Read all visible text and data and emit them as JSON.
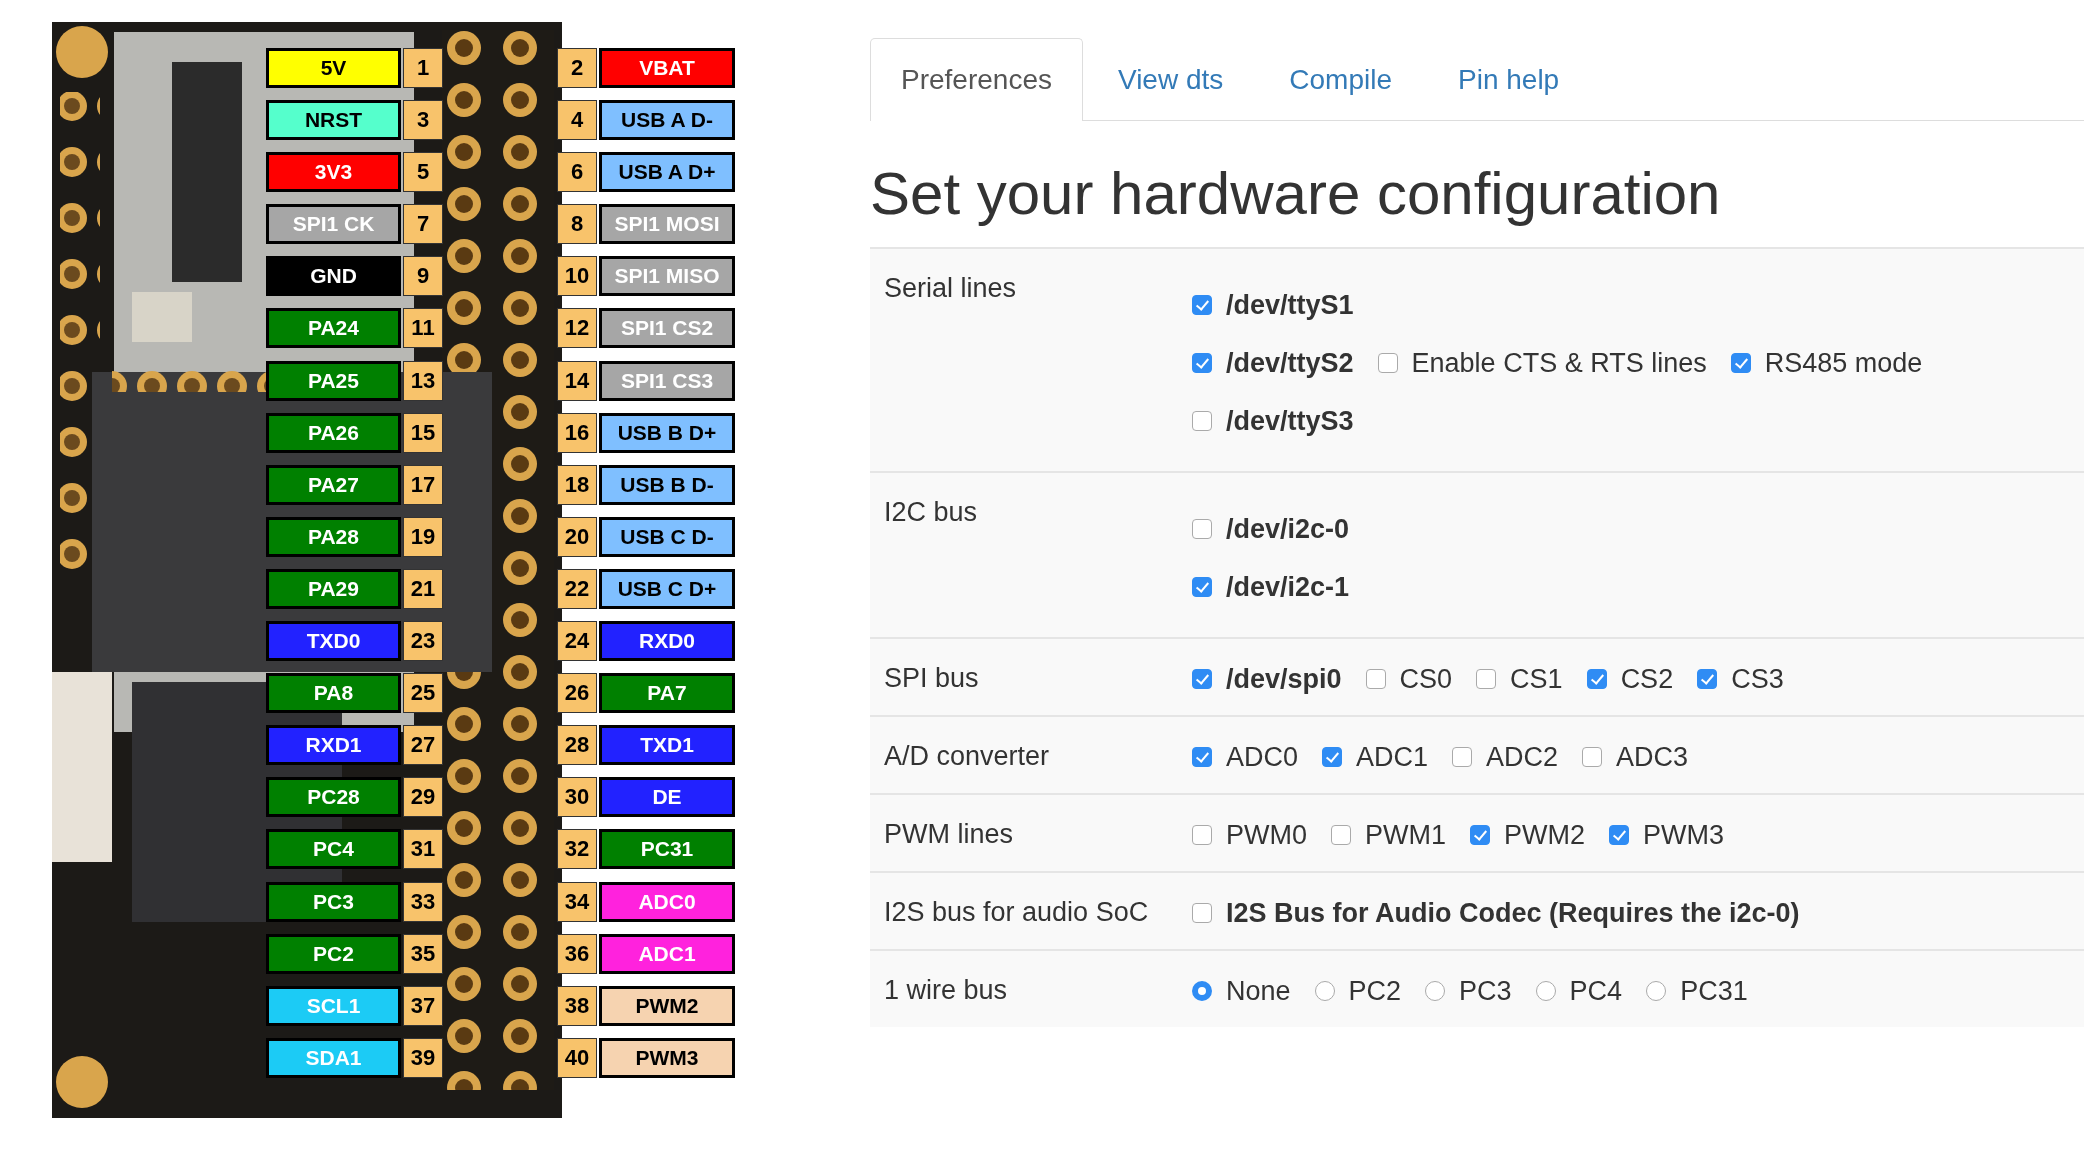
{
  "board": {
    "kind": "picture",
    "pin_rows": [
      {
        "left": {
          "name": "5V",
          "number": "1",
          "color": "#ffff00",
          "kind": "dark-text"
        },
        "right": {
          "number": "2",
          "name": "VBAT",
          "color": "#ff0000",
          "kind": "light-text"
        }
      },
      {
        "left": {
          "name": "NRST",
          "number": "3",
          "color": "#55ffcc",
          "kind": "dark-text"
        },
        "right": {
          "number": "4",
          "name": "USB A D-",
          "color": "#7fbfff",
          "kind": "dark-text"
        }
      },
      {
        "left": {
          "name": "3V3",
          "number": "5",
          "color": "#ff0000",
          "kind": "light-text"
        },
        "right": {
          "number": "6",
          "name": "USB A D+",
          "color": "#7fbfff",
          "kind": "dark-text"
        }
      },
      {
        "left": {
          "name": "SPI1 CK",
          "number": "7",
          "color": "#a6a6a6",
          "kind": "light-text"
        },
        "right": {
          "number": "8",
          "name": "SPI1 MOSI",
          "color": "#a6a6a6",
          "kind": "light-text"
        }
      },
      {
        "left": {
          "name": "GND",
          "number": "9",
          "color": "#000000",
          "kind": "light-text"
        },
        "right": {
          "number": "10",
          "name": "SPI1 MISO",
          "color": "#a6a6a6",
          "kind": "light-text"
        }
      },
      {
        "left": {
          "name": "PA24",
          "number": "11",
          "color": "#008000",
          "kind": "light-text"
        },
        "right": {
          "number": "12",
          "name": "SPI1 CS2",
          "color": "#a6a6a6",
          "kind": "light-text"
        }
      },
      {
        "left": {
          "name": "PA25",
          "number": "13",
          "color": "#008000",
          "kind": "light-text"
        },
        "right": {
          "number": "14",
          "name": "SPI1 CS3",
          "color": "#a6a6a6",
          "kind": "light-text"
        }
      },
      {
        "left": {
          "name": "PA26",
          "number": "15",
          "color": "#008000",
          "kind": "light-text"
        },
        "right": {
          "number": "16",
          "name": "USB B D+",
          "color": "#7fbfff",
          "kind": "dark-text"
        }
      },
      {
        "left": {
          "name": "PA27",
          "number": "17",
          "color": "#008000",
          "kind": "light-text"
        },
        "right": {
          "number": "18",
          "name": "USB B D-",
          "color": "#7fbfff",
          "kind": "dark-text"
        }
      },
      {
        "left": {
          "name": "PA28",
          "number": "19",
          "color": "#008000",
          "kind": "light-text"
        },
        "right": {
          "number": "20",
          "name": "USB C D-",
          "color": "#7fbfff",
          "kind": "dark-text"
        }
      },
      {
        "left": {
          "name": "PA29",
          "number": "21",
          "color": "#008000",
          "kind": "light-text"
        },
        "right": {
          "number": "22",
          "name": "USB C D+",
          "color": "#7fbfff",
          "kind": "dark-text"
        }
      },
      {
        "left": {
          "name": "TXD0",
          "number": "23",
          "color": "#2222ff",
          "kind": "light-text"
        },
        "right": {
          "number": "24",
          "name": "RXD0",
          "color": "#2222ff",
          "kind": "light-text"
        }
      },
      {
        "left": {
          "name": "PA8",
          "number": "25",
          "color": "#008000",
          "kind": "light-text"
        },
        "right": {
          "number": "26",
          "name": "PA7",
          "color": "#008000",
          "kind": "light-text"
        }
      },
      {
        "left": {
          "name": "RXD1",
          "number": "27",
          "color": "#2222ff",
          "kind": "light-text"
        },
        "right": {
          "number": "28",
          "name": "TXD1",
          "color": "#2222ff",
          "kind": "light-text"
        }
      },
      {
        "left": {
          "name": "PC28",
          "number": "29",
          "color": "#008000",
          "kind": "light-text"
        },
        "right": {
          "number": "30",
          "name": "DE",
          "color": "#2222ff",
          "kind": "light-text"
        }
      },
      {
        "left": {
          "name": "PC4",
          "number": "31",
          "color": "#008000",
          "kind": "light-text"
        },
        "right": {
          "number": "32",
          "name": "PC31",
          "color": "#008000",
          "kind": "light-text"
        }
      },
      {
        "left": {
          "name": "PC3",
          "number": "33",
          "color": "#008000",
          "kind": "light-text"
        },
        "right": {
          "number": "34",
          "name": "ADC0",
          "color": "#ff22dd",
          "kind": "light-text"
        }
      },
      {
        "left": {
          "name": "PC2",
          "number": "35",
          "color": "#008000",
          "kind": "light-text"
        },
        "right": {
          "number": "36",
          "name": "ADC1",
          "color": "#ff22dd",
          "kind": "light-text"
        }
      },
      {
        "left": {
          "name": "SCL1",
          "number": "37",
          "color": "#1ccbf5",
          "kind": "light-text"
        },
        "right": {
          "number": "38",
          "name": "PWM2",
          "color": "#f6d3b0",
          "kind": "dark-text"
        }
      },
      {
        "left": {
          "name": "SDA1",
          "number": "39",
          "color": "#1ccbf5",
          "kind": "light-text"
        },
        "right": {
          "number": "40",
          "name": "PWM3",
          "color": "#f6d3b0",
          "kind": "dark-text"
        }
      }
    ]
  },
  "tabs": [
    {
      "label": "Preferences",
      "selected": true
    },
    {
      "label": "View dts",
      "selected": false
    },
    {
      "label": "Compile",
      "selected": false
    },
    {
      "label": "Pin help",
      "selected": false
    }
  ],
  "title": "Set your hardware configuration",
  "sections": [
    {
      "label": "Serial lines",
      "lines": [
        [
          {
            "kind": "checkbox",
            "label": "/dev/ttyS1",
            "bold": true,
            "checked": true
          }
        ],
        [
          {
            "kind": "checkbox",
            "label": "/dev/ttyS2",
            "bold": true,
            "checked": true
          },
          {
            "kind": "checkbox",
            "label": "Enable CTS & RTS lines",
            "bold": false,
            "checked": false
          },
          {
            "kind": "checkbox",
            "label": "RS485 mode",
            "bold": false,
            "checked": true
          }
        ],
        [
          {
            "kind": "checkbox",
            "label": "/dev/ttyS3",
            "bold": true,
            "checked": false
          }
        ]
      ]
    },
    {
      "label": "I2C bus",
      "lines": [
        [
          {
            "kind": "checkbox",
            "label": "/dev/i2c-0",
            "bold": true,
            "checked": false
          }
        ],
        [
          {
            "kind": "checkbox",
            "label": "/dev/i2c-1",
            "bold": true,
            "checked": true
          }
        ]
      ]
    },
    {
      "label": "SPI bus",
      "lines": [
        [
          {
            "kind": "checkbox",
            "label": "/dev/spi0",
            "bold": true,
            "checked": true
          },
          {
            "kind": "checkbox",
            "label": "CS0",
            "bold": false,
            "checked": false
          },
          {
            "kind": "checkbox",
            "label": "CS1",
            "bold": false,
            "checked": false
          },
          {
            "kind": "checkbox",
            "label": "CS2",
            "bold": false,
            "checked": true
          },
          {
            "kind": "checkbox",
            "label": "CS3",
            "bold": false,
            "checked": true
          }
        ]
      ]
    },
    {
      "label": "A/D converter",
      "lines": [
        [
          {
            "kind": "checkbox",
            "label": "ADC0",
            "bold": false,
            "checked": true
          },
          {
            "kind": "checkbox",
            "label": "ADC1",
            "bold": false,
            "checked": true
          },
          {
            "kind": "checkbox",
            "label": "ADC2",
            "bold": false,
            "checked": false
          },
          {
            "kind": "checkbox",
            "label": "ADC3",
            "bold": false,
            "checked": false
          }
        ]
      ]
    },
    {
      "label": "PWM lines",
      "lines": [
        [
          {
            "kind": "checkbox",
            "label": "PWM0",
            "bold": false,
            "checked": false
          },
          {
            "kind": "checkbox",
            "label": "PWM1",
            "bold": false,
            "checked": false
          },
          {
            "kind": "checkbox",
            "label": "PWM2",
            "bold": false,
            "checked": true
          },
          {
            "kind": "checkbox",
            "label": "PWM3",
            "bold": false,
            "checked": true
          }
        ]
      ]
    },
    {
      "label": "I2S bus for audio SoC",
      "lines": [
        [
          {
            "kind": "checkbox",
            "label": "I2S Bus for Audio Codec (Requires the i2c-0)",
            "bold": true,
            "checked": false
          }
        ]
      ]
    },
    {
      "label": "1 wire bus",
      "lines": [
        [
          {
            "kind": "radio",
            "label": "None",
            "bold": false,
            "selected": true
          },
          {
            "kind": "radio",
            "label": "PC2",
            "bold": false,
            "selected": false
          },
          {
            "kind": "radio",
            "label": "PC3",
            "bold": false,
            "selected": false
          },
          {
            "kind": "radio",
            "label": "PC4",
            "bold": false,
            "selected": false
          },
          {
            "kind": "radio",
            "label": "PC31",
            "bold": false,
            "selected": false
          }
        ]
      ]
    }
  ]
}
